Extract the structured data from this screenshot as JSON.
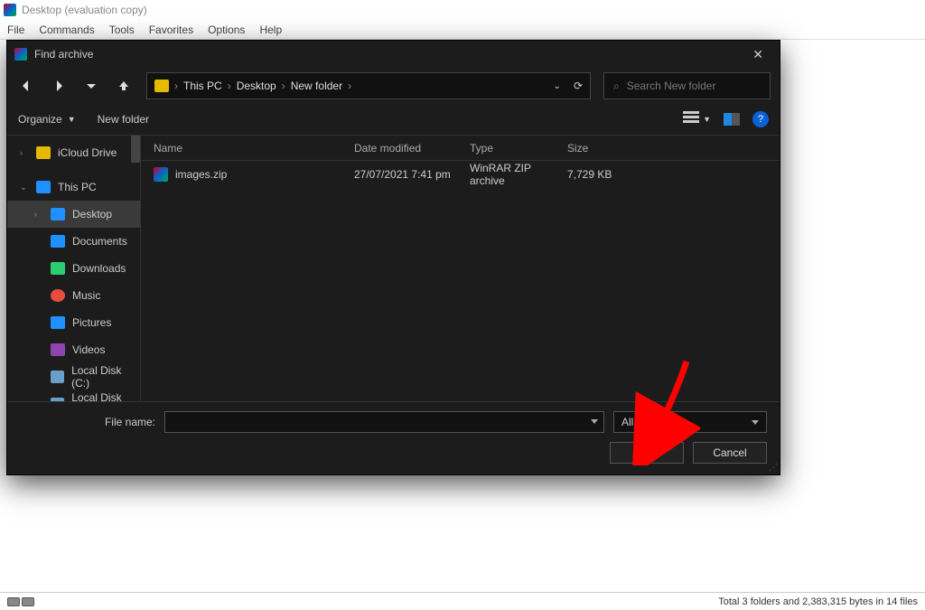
{
  "parent": {
    "title": "Desktop (evaluation copy)",
    "menu": [
      "File",
      "Commands",
      "Tools",
      "Favorites",
      "Options",
      "Help"
    ],
    "status": "Total 3 folders and 2,383,315 bytes in 14 files"
  },
  "dialog": {
    "title": "Find archive",
    "breadcrumb": [
      "This PC",
      "Desktop",
      "New folder"
    ],
    "search_placeholder": "Search New folder",
    "toolbar": {
      "organize": "Organize",
      "newfolder": "New folder"
    },
    "sidebar": [
      {
        "label": "iCloud Drive",
        "caret": "›",
        "color": "#e6b800",
        "sub": false
      },
      {
        "label": "This PC",
        "caret": "⌄",
        "color": "#1e90ff",
        "sub": false
      },
      {
        "label": "Desktop",
        "caret": "›",
        "color": "#1e90ff",
        "sub": true,
        "selected": true
      },
      {
        "label": "Documents",
        "caret": "",
        "color": "#1e90ff",
        "sub": true
      },
      {
        "label": "Downloads",
        "caret": "",
        "color": "#2ecc71",
        "sub": true
      },
      {
        "label": "Music",
        "caret": "",
        "color": "#e74c3c",
        "sub": true
      },
      {
        "label": "Pictures",
        "caret": "",
        "color": "#1e90ff",
        "sub": true
      },
      {
        "label": "Videos",
        "caret": "",
        "color": "#8e44ad",
        "sub": true
      },
      {
        "label": "Local Disk (C:)",
        "caret": "",
        "color": "#6aa0c8",
        "sub": true
      },
      {
        "label": "Local Disk (E:)",
        "caret": "",
        "color": "#6aa0c8",
        "sub": true
      }
    ],
    "columns": {
      "name": "Name",
      "date": "Date modified",
      "type": "Type",
      "size": "Size"
    },
    "files": [
      {
        "name": "images.zip",
        "date": "27/07/2021 7:41 pm",
        "type": "WinRAR ZIP archive",
        "size": "7,729 KB"
      }
    ],
    "filename_label": "File name:",
    "filter": "All archives",
    "open": "Open",
    "cancel": "Cancel"
  }
}
